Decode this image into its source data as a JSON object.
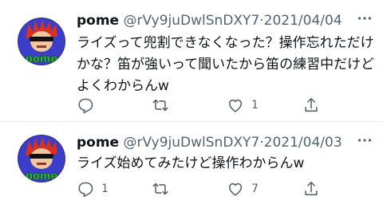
{
  "tweets": [
    {
      "author": {
        "name": "pome",
        "handle": "@rVy9juDwlSnDXY7",
        "avatar_text": "pome"
      },
      "separator": "·",
      "date": "2021/04/04",
      "text": "ライズって兜割できなくなった？操作忘れただけかな？笛が強いって聞いたから笛の練習中だけどよくわからんw",
      "actions": {
        "reply": {
          "icon": "reply-icon",
          "count": ""
        },
        "retweet": {
          "icon": "retweet-icon",
          "count": ""
        },
        "like": {
          "icon": "heart-icon",
          "count": "1"
        },
        "share": {
          "icon": "share-icon",
          "count": ""
        }
      }
    },
    {
      "author": {
        "name": "pome",
        "handle": "@rVy9juDwlSnDXY7",
        "avatar_text": "pome"
      },
      "separator": "·",
      "date": "2021/04/03",
      "text": "ライズ始めてみたけど操作わからんw",
      "actions": {
        "reply": {
          "icon": "reply-icon",
          "count": "1"
        },
        "retweet": {
          "icon": "retweet-icon",
          "count": ""
        },
        "like": {
          "icon": "heart-icon",
          "count": "7"
        },
        "share": {
          "icon": "share-icon",
          "count": ""
        }
      }
    }
  ]
}
